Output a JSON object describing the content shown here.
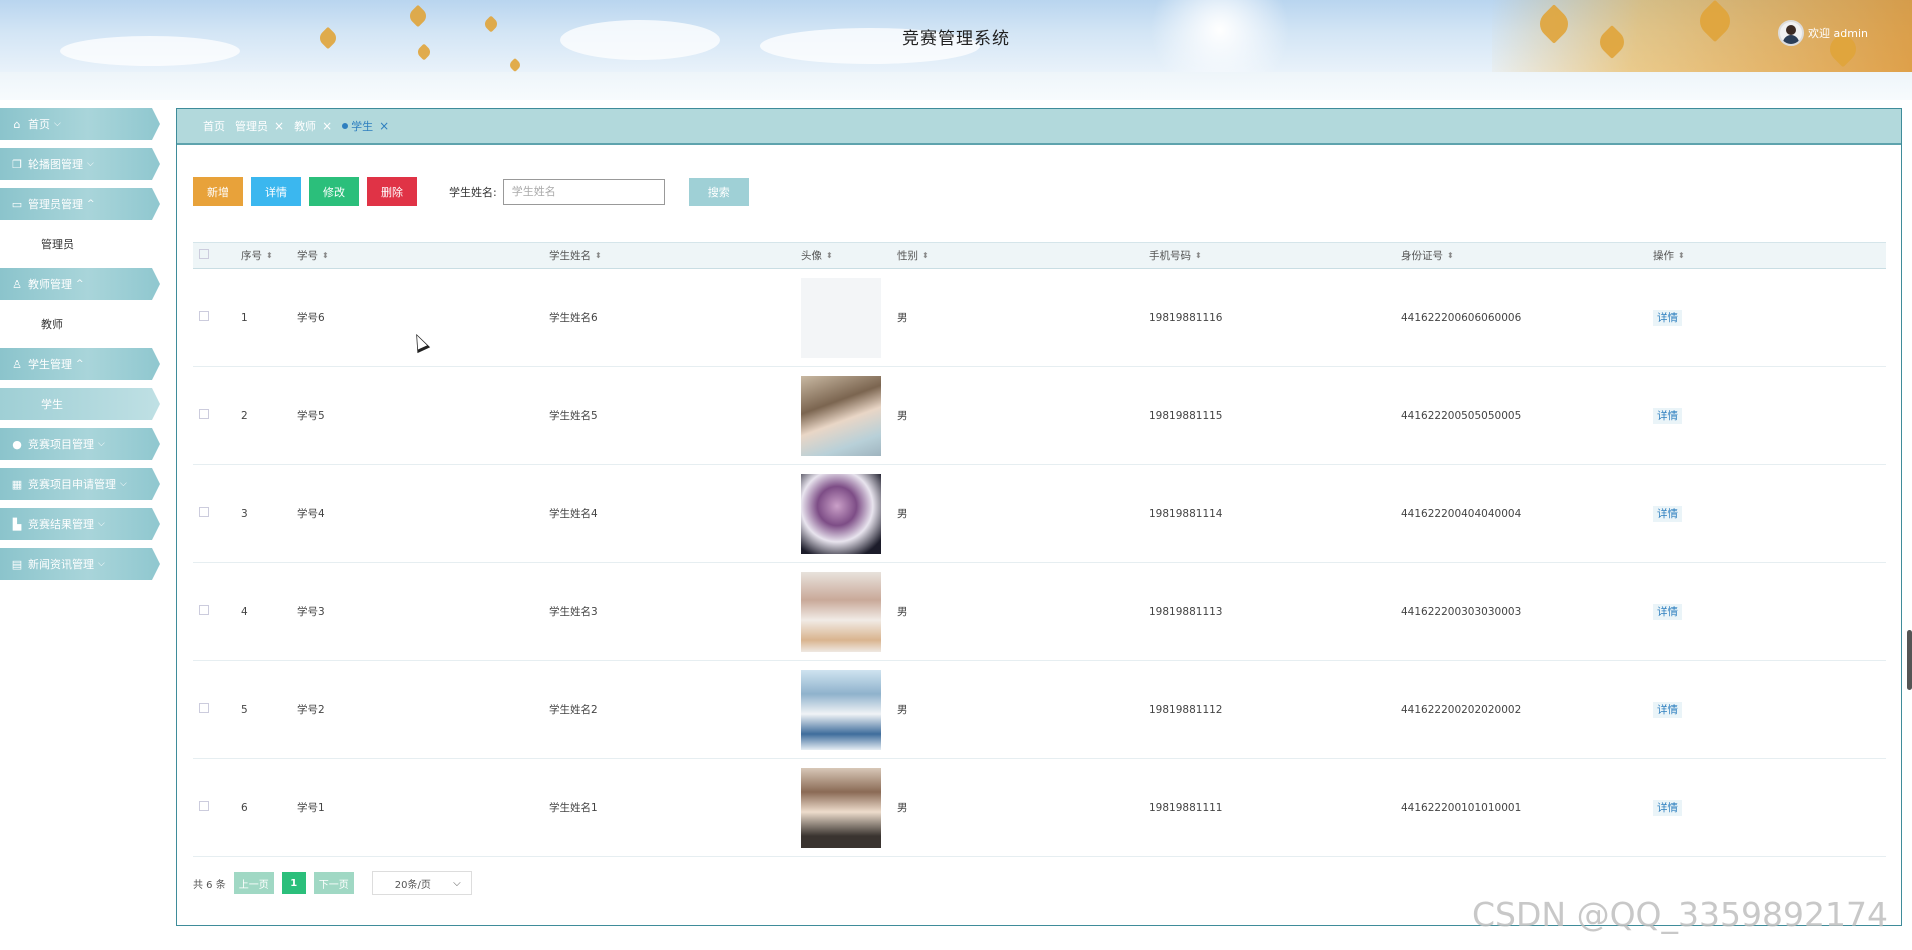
{
  "header": {
    "title": "竞赛管理系统",
    "welcome": "欢迎 admin"
  },
  "sidebar": {
    "items": [
      {
        "label": "首页",
        "icon": "home-icon",
        "expanded": false
      },
      {
        "label": "轮播图管理",
        "icon": "copy-icon",
        "expanded": false
      },
      {
        "label": "管理员管理",
        "icon": "card-icon",
        "expanded": true,
        "children": [
          "管理员"
        ]
      },
      {
        "label": "教师管理",
        "icon": "user-icon",
        "expanded": true,
        "children": [
          "教师"
        ]
      },
      {
        "label": "学生管理",
        "icon": "user-icon",
        "expanded": true,
        "children": [
          "学生"
        ]
      },
      {
        "label": "竞赛项目管理",
        "icon": "circle-icon",
        "expanded": false
      },
      {
        "label": "竞赛项目申请管理",
        "icon": "grid-icon",
        "expanded": false
      },
      {
        "label": "竞赛结果管理",
        "icon": "chart-icon",
        "expanded": false
      },
      {
        "label": "新闻资讯管理",
        "icon": "news-icon",
        "expanded": false
      }
    ]
  },
  "tabs": [
    {
      "label": "首页",
      "closable": false
    },
    {
      "label": "管理员",
      "closable": true
    },
    {
      "label": "教师",
      "closable": true
    },
    {
      "label": "学生",
      "closable": true,
      "active": true
    }
  ],
  "toolbar": {
    "add_label": "新增",
    "detail_label": "详情",
    "edit_label": "修改",
    "delete_label": "删除",
    "search_label": "学生姓名:",
    "search_placeholder": "学生姓名",
    "search_button": "搜索"
  },
  "table": {
    "columns": [
      "序号",
      "学号",
      "学生姓名",
      "头像",
      "性别",
      "手机号码",
      "身份证号",
      "操作"
    ],
    "rows": [
      {
        "index": "1",
        "student_no": "学号6",
        "name": "学生姓名6",
        "photo": "blank",
        "gender": "男",
        "phone": "19819881116",
        "id_card": "441622200606060006",
        "action": "详情"
      },
      {
        "index": "2",
        "student_no": "学号5",
        "name": "学生姓名5",
        "photo": "photo-a",
        "gender": "男",
        "phone": "19819881115",
        "id_card": "441622200505050005",
        "action": "详情"
      },
      {
        "index": "3",
        "student_no": "学号4",
        "name": "学生姓名4",
        "photo": "photo-b",
        "gender": "男",
        "phone": "19819881114",
        "id_card": "441622200404040004",
        "action": "详情"
      },
      {
        "index": "4",
        "student_no": "学号3",
        "name": "学生姓名3",
        "photo": "photo-c",
        "gender": "男",
        "phone": "19819881113",
        "id_card": "441622200303030003",
        "action": "详情"
      },
      {
        "index": "5",
        "student_no": "学号2",
        "name": "学生姓名2",
        "photo": "photo-d",
        "gender": "男",
        "phone": "19819881112",
        "id_card": "441622200202020002",
        "action": "详情"
      },
      {
        "index": "6",
        "student_no": "学号1",
        "name": "学生姓名1",
        "photo": "photo-e",
        "gender": "男",
        "phone": "19819881111",
        "id_card": "441622200101010001",
        "action": "详情"
      }
    ]
  },
  "pagination": {
    "total": "共 6 条",
    "prev": "上一页",
    "current": "1",
    "next": "下一页",
    "page_size": "20条/页"
  },
  "watermark": "CSDN @QQ_3359892174",
  "colors": {
    "accent": "#8bc4cc",
    "add": "#e8a23a",
    "detail": "#3bb7ef",
    "edit": "#2bbf7b",
    "delete": "#e03346"
  }
}
